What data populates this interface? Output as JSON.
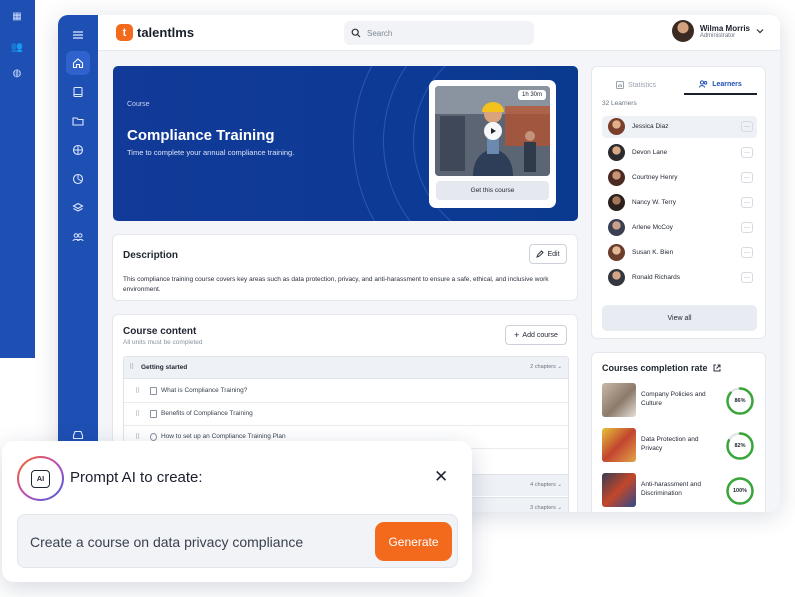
{
  "app": {
    "logo_text": "talentlms",
    "logo_letter": "t",
    "search_placeholder": "Search",
    "user": {
      "name": "Wilma Morris",
      "role": "Administrator"
    }
  },
  "hero": {
    "kicker": "Course",
    "title": "Compliance Training",
    "subtitle": "Time to complete your annual compliance training.",
    "duration": "1h 30m",
    "cta": "Get this course"
  },
  "description": {
    "title": "Description",
    "edit_label": "Edit",
    "text": "This compliance training course covers key areas such as data protection, privacy, and anti-harassment to ensure a safe, ethical, and inclusive work environment."
  },
  "content": {
    "title": "Course content",
    "subtitle": "All units must be completed",
    "add_label": "Add course",
    "sections": [
      {
        "name": "Getting started",
        "chapters": "2 chapters",
        "units": [
          "What is Compliance Training?",
          "Benefits of Compliance Training",
          "How to set up an Compliance Training Plan"
        ]
      },
      {
        "name": "",
        "chapters": "4 chapters"
      },
      {
        "name": "",
        "chapters": "3 chapters"
      }
    ]
  },
  "learners": {
    "tab_statistics": "Statistics",
    "tab_learners": "Learners",
    "count": "32 Learners",
    "items": [
      {
        "name": "Jessica Diaz",
        "more": "···"
      },
      {
        "name": "Devon Lane",
        "more": "···"
      },
      {
        "name": "Courtney Henry",
        "more": "···"
      },
      {
        "name": "Nancy W. Terry",
        "more": "···"
      },
      {
        "name": "Arlene McCoy",
        "more": "···"
      },
      {
        "name": "Susan K. Bien",
        "more": "···"
      },
      {
        "name": "Ronald Richards",
        "more": "···"
      }
    ],
    "view_all": "View all"
  },
  "completion": {
    "title": "Courses completion rate",
    "items": [
      {
        "label": "Company Policies and Culture",
        "percent": 86,
        "percent_label": "86%"
      },
      {
        "label": "Data Protection and Privacy",
        "percent": 82,
        "percent_label": "82%"
      },
      {
        "label": "Anti-harassment and Discrimination",
        "percent": 100,
        "percent_label": "100%"
      }
    ]
  },
  "prompt": {
    "badge": "AI",
    "title": "Prompt AI to create:",
    "close": "✕",
    "input_text": "Create a course on data privacy compliance",
    "generate_label": "Generate"
  },
  "colors": {
    "brand_blue": "#1e4fb3",
    "accent_orange": "#f36a1d",
    "ring_green": "#3aa63a"
  }
}
